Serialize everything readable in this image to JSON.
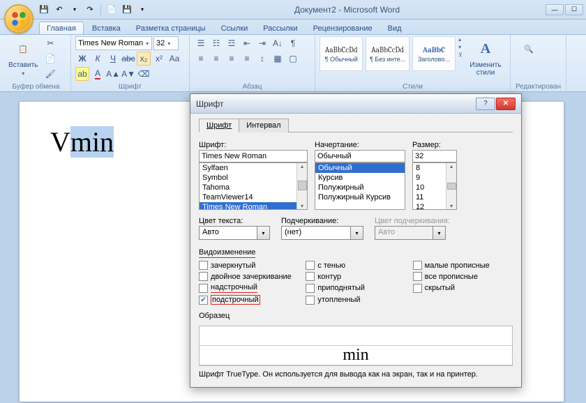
{
  "window": {
    "title": "Документ2 - Microsoft Word"
  },
  "tabs": {
    "home": "Главная",
    "insert": "Вставка",
    "layout": "Разметка страницы",
    "refs": "Ссылки",
    "mail": "Рассылки",
    "review": "Рецензирование",
    "view": "Вид"
  },
  "ribbon": {
    "paste": "Вставить",
    "clipboard": "Буфер обмена",
    "font_group": "Шрифт",
    "para_group": "Абзац",
    "styles_group": "Стили",
    "edit_group": "Редактирован",
    "font_name": "Times New Roman",
    "font_size": "32",
    "style_preview": "AaBbCcDd",
    "style_heading_preview": "AaBbC",
    "style1": "¶ Обычный",
    "style2": "¶ Без инте...",
    "style3": "Заголово...",
    "change_styles": "Изменить стили"
  },
  "doc": {
    "text_v": "V",
    "text_min": "min"
  },
  "dialog": {
    "title": "Шрифт",
    "tab_font": "Шрифт",
    "tab_spacing": "Интервал",
    "lbl_font": "Шрифт:",
    "lbl_style": "Начертание:",
    "lbl_size": "Размер:",
    "font_value": "Times New Roman",
    "style_value": "Обычный",
    "size_value": "32",
    "font_list": [
      "Sylfaen",
      "Symbol",
      "Tahoma",
      "TeamViewer14",
      "Times New Roman"
    ],
    "style_list": [
      "Обычный",
      "Курсив",
      "Полужирный",
      "Полужирный Курсив"
    ],
    "size_list": [
      "8",
      "9",
      "10",
      "11",
      "12"
    ],
    "lbl_color": "Цвет текста:",
    "lbl_underline": "Подчеркивание:",
    "lbl_ucolor": "Цвет подчеркивания:",
    "color_val": "Авто",
    "underline_val": "(нет)",
    "ucolor_val": "Авто",
    "lbl_effects": "Видоизменение",
    "chk_strike": "зачеркнутый",
    "chk_shadow": "с тенью",
    "chk_smallcaps": "малые прописные",
    "chk_dstrike": "двойное зачеркивание",
    "chk_outline": "контур",
    "chk_allcaps": "все прописные",
    "chk_super": "надстрочный",
    "chk_emboss": "приподнятый",
    "chk_hidden": "скрытый",
    "chk_sub": "подстрочный",
    "chk_engrave": "утопленный",
    "lbl_sample": "Образец",
    "sample_text": "min",
    "desc": "Шрифт TrueType. Он используется для вывода как на экран, так и на принтер."
  }
}
